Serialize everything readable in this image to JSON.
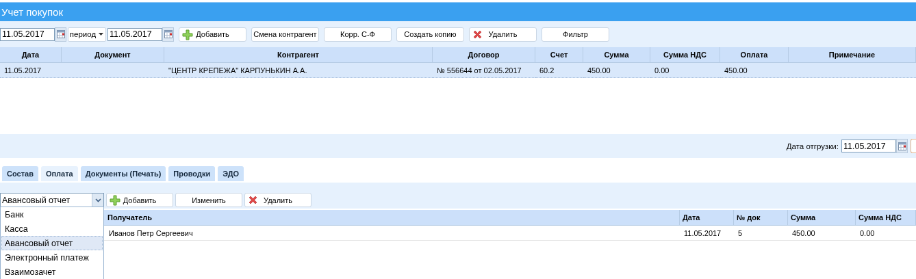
{
  "window": {
    "title": "Учет покупок"
  },
  "toolbar": {
    "date_from": "11.05.2017",
    "period": "период",
    "date_to": "11.05.2017",
    "buttons": [
      {
        "label": "Добавить",
        "kind": "add"
      },
      {
        "label": "Смена контрагент",
        "kind": "plain"
      },
      {
        "label": "Корр. С-Ф",
        "kind": "plain"
      },
      {
        "label": "Создать копию",
        "kind": "plain"
      },
      {
        "label": "Удалить",
        "kind": "delete"
      },
      {
        "label": "Фильтр",
        "kind": "plain"
      }
    ]
  },
  "purchases_table": {
    "columns": [
      "Дата",
      "Документ",
      "Контрагент",
      "Договор",
      "Счет",
      "Сумма",
      "Сумма НДС",
      "Оплата",
      "Примечание"
    ],
    "rows": [
      {
        "selected": true,
        "cells": [
          "11.05.2017",
          "",
          "\"ЦЕНТР КРЕПЕЖА\" КАРПУНЬКИН А.А.",
          "№ 556644 от 02.05.2017",
          "60.2",
          "450.00",
          "0.00",
          "450.00",
          ""
        ]
      }
    ]
  },
  "shipment_date": {
    "label": "Дата отгрузки:",
    "value": "11.05.2017"
  },
  "tabs": [
    {
      "label": "Состав",
      "selected": false
    },
    {
      "label": "Оплата",
      "selected": true
    },
    {
      "label": "Документы (Печать)",
      "selected": false
    },
    {
      "label": "Проводки",
      "selected": false
    },
    {
      "label": "ЭДО",
      "selected": false
    }
  ],
  "payment_toolbar": {
    "type_value": "Авансовый отчет",
    "buttons": [
      {
        "label": "Добавить",
        "kind": "add"
      },
      {
        "label": "Изменить",
        "kind": "plain"
      },
      {
        "label": "Удалить",
        "kind": "delete"
      }
    ]
  },
  "payment_type_options": [
    {
      "label": "Банк",
      "selected": false
    },
    {
      "label": "Касса",
      "selected": false
    },
    {
      "label": "Авансовый отчет",
      "selected": true
    },
    {
      "label": "Электронный платеж",
      "selected": false
    },
    {
      "label": "Взаимозачет",
      "selected": false
    }
  ],
  "payments_table": {
    "columns": [
      "Получатель",
      "Дата",
      "№ док",
      "Сумма",
      "Сумма НДС"
    ],
    "rows": [
      {
        "selected": false,
        "cells": [
          "Иванов Петр Сергеевич",
          "11.05.2017",
          "5",
          "450.00",
          "0.00"
        ]
      }
    ]
  }
}
